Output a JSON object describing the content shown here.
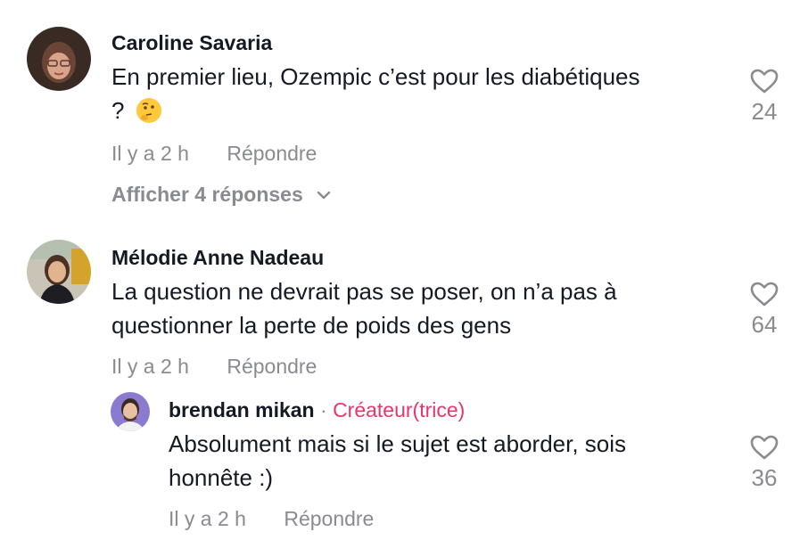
{
  "comments": [
    {
      "author": "Caroline Savaria",
      "text": "En premier lieu, Ozempic c’est pour les diabétiques",
      "text_line2": "?",
      "emoji": "thinking-face",
      "time": "Il y a 2 h",
      "reply_label": "Répondre",
      "likes": "24",
      "show_replies": "Afficher 4 réponses"
    },
    {
      "author": "Mélodie Anne Nadeau",
      "text": "La question ne devrait pas se poser, on n’a pas à questionner la perte de poids des gens",
      "time": "Il y a 2 h",
      "reply_label": "Répondre",
      "likes": "64"
    }
  ],
  "reply": {
    "author": "brendan mikan",
    "separator": "·",
    "creator_tag": "Créateur(trice)",
    "text": "Absolument mais si le sujet est aborder, sois honnête :)",
    "time": "Il y a 2 h",
    "reply_label": "Répondre",
    "likes": "36"
  },
  "colors": {
    "creator_tag": "#e8356a",
    "muted": "#8a8b91",
    "text": "#161823"
  }
}
